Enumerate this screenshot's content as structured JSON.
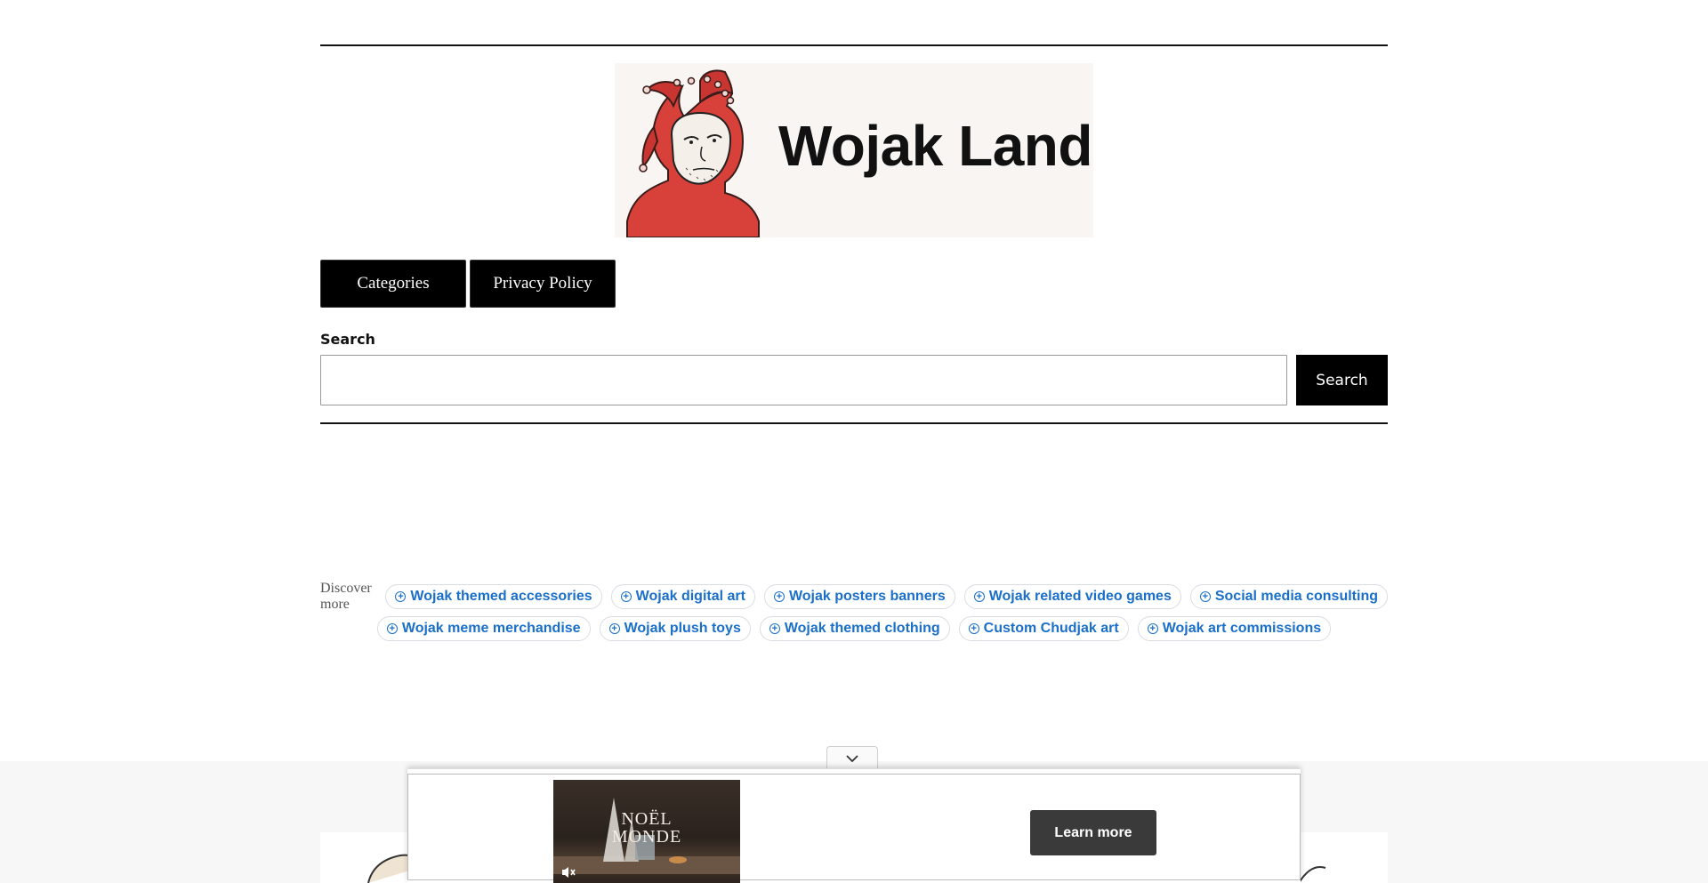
{
  "site": {
    "logo_text": "Wojak Land"
  },
  "nav": {
    "items": [
      {
        "label": "Categories"
      },
      {
        "label": "Privacy Policy"
      }
    ]
  },
  "search": {
    "label": "Search",
    "value": "",
    "placeholder": "",
    "button_label": "Search"
  },
  "discover": {
    "label": "Discover more",
    "chips": [
      "Wojak themed accessories",
      "Wojak digital art",
      "Wojak posters banners",
      "Wojak related video games",
      "Social media consulting",
      "Wojak meme merchandise",
      "Wojak plush toys",
      "Wojak themed clothing",
      "Custom Chudjak art",
      "Wojak art commissions"
    ]
  },
  "ad": {
    "video_line1": "NOËL",
    "video_line2": "MONDE",
    "learn_more_label": "Learn more",
    "toggle_icon": "chevron-down-icon",
    "mute_icon": "muted-speaker-icon"
  },
  "colors": {
    "chip_text": "#1a6fc9",
    "nav_bg": "#000000",
    "logo_bg": "#f8f5f3",
    "jester_red": "#d8403a"
  }
}
